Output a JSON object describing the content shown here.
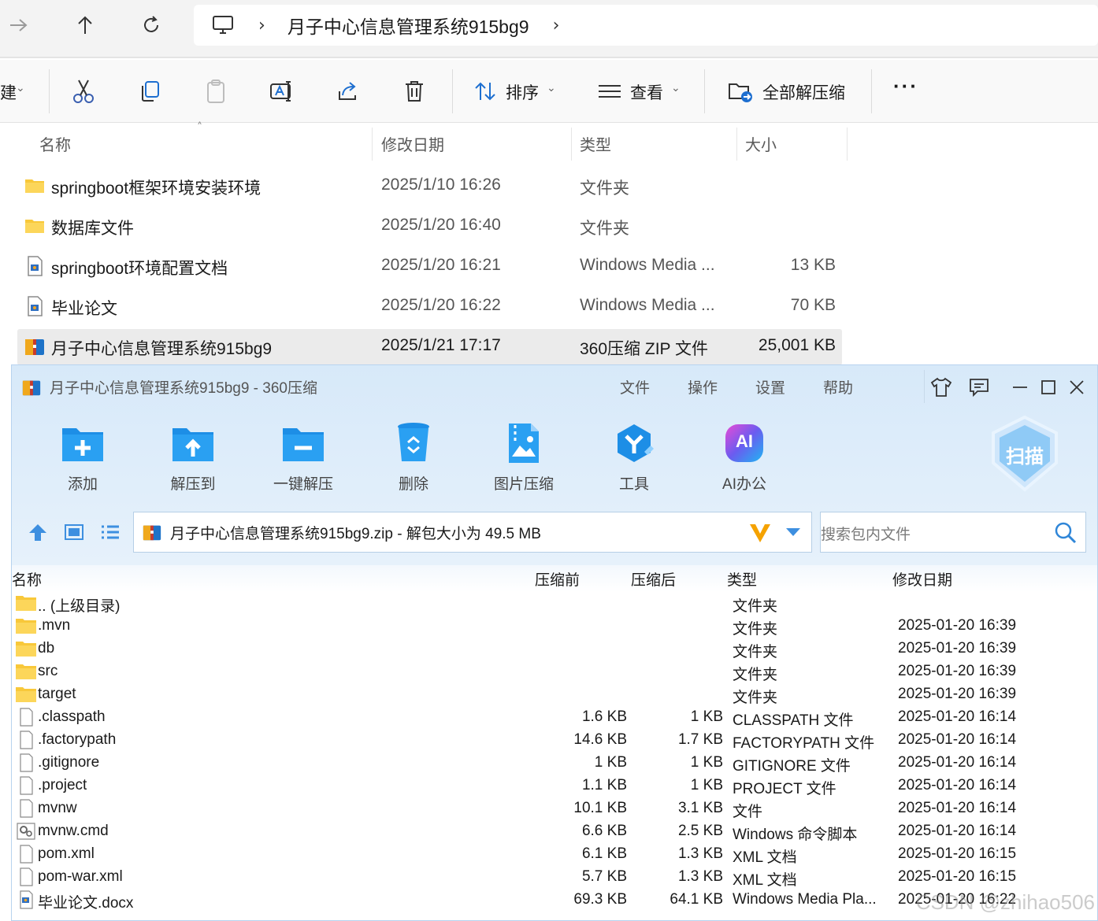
{
  "explorer": {
    "address_path": "月子中心信息管理系统915bg9",
    "toolbar": {
      "new_label_fragment": "建",
      "sort_label": "排序",
      "view_label": "查看",
      "extract_all_label": "全部解压缩"
    },
    "columns": {
      "name": "名称",
      "modified": "修改日期",
      "type": "类型",
      "size": "大小"
    },
    "files": [
      {
        "name": "springboot框架环境安装环境",
        "modified": "2025/1/10 16:26",
        "type": "文件夹",
        "size": "",
        "icon": "folder-icon"
      },
      {
        "name": "数据库文件",
        "modified": "2025/1/20 16:40",
        "type": "文件夹",
        "size": "",
        "icon": "folder-icon"
      },
      {
        "name": "springboot环境配置文档",
        "modified": "2025/1/20 16:21",
        "type": "Windows Media ...",
        "size": "13 KB",
        "icon": "document-icon"
      },
      {
        "name": "毕业论文",
        "modified": "2025/1/20 16:22",
        "type": "Windows Media ...",
        "size": "70 KB",
        "icon": "document-icon"
      },
      {
        "name": "月子中心信息管理系统915bg9",
        "modified": "2025/1/21 17:17",
        "type": "360压缩 ZIP 文件",
        "size": "25,001 KB",
        "icon": "zip-archive-icon"
      }
    ]
  },
  "zip_window": {
    "title": "月子中心信息管理系统915bg9 - 360压缩",
    "menu": [
      "文件",
      "操作",
      "设置",
      "帮助"
    ],
    "tools": [
      "添加",
      "解压到",
      "一键解压",
      "删除",
      "图片压缩",
      "工具",
      "AI办公"
    ],
    "scan_label": "扫描",
    "ai_badge": "AI",
    "path_text": "月子中心信息管理系统915bg9.zip - 解包大小为 49.5 MB",
    "search_placeholder": "搜索包内文件",
    "columns": {
      "name": "名称",
      "before": "压缩前",
      "after": "压缩后",
      "type": "类型",
      "modified": "修改日期"
    },
    "rows": [
      {
        "name": ".. (上级目录)",
        "before": "",
        "after": "",
        "type": "文件夹",
        "modified": "",
        "icon": "folder-icon"
      },
      {
        "name": ".mvn",
        "before": "",
        "after": "",
        "type": "文件夹",
        "modified": "2025-01-20 16:39",
        "icon": "folder-icon"
      },
      {
        "name": "db",
        "before": "",
        "after": "",
        "type": "文件夹",
        "modified": "2025-01-20 16:39",
        "icon": "folder-icon"
      },
      {
        "name": "src",
        "before": "",
        "after": "",
        "type": "文件夹",
        "modified": "2025-01-20 16:39",
        "icon": "folder-icon"
      },
      {
        "name": "target",
        "before": "",
        "after": "",
        "type": "文件夹",
        "modified": "2025-01-20 16:39",
        "icon": "folder-icon"
      },
      {
        "name": ".classpath",
        "before": "1.6 KB",
        "after": "1 KB",
        "type": "CLASSPATH 文件",
        "modified": "2025-01-20 16:14",
        "icon": "file-icon"
      },
      {
        "name": ".factorypath",
        "before": "14.6 KB",
        "after": "1.7 KB",
        "type": "FACTORYPATH 文件",
        "modified": "2025-01-20 16:14",
        "icon": "file-icon"
      },
      {
        "name": ".gitignore",
        "before": "1 KB",
        "after": "1 KB",
        "type": "GITIGNORE 文件",
        "modified": "2025-01-20 16:14",
        "icon": "file-icon"
      },
      {
        "name": ".project",
        "before": "1.1 KB",
        "after": "1 KB",
        "type": "PROJECT 文件",
        "modified": "2025-01-20 16:14",
        "icon": "file-icon"
      },
      {
        "name": "mvnw",
        "before": "10.1 KB",
        "after": "3.1 KB",
        "type": "文件",
        "modified": "2025-01-20 16:14",
        "icon": "file-icon"
      },
      {
        "name": "mvnw.cmd",
        "before": "6.6 KB",
        "after": "2.5 KB",
        "type": "Windows 命令脚本",
        "modified": "2025-01-20 16:14",
        "icon": "script-file-icon"
      },
      {
        "name": "pom.xml",
        "before": "6.1 KB",
        "after": "1.3 KB",
        "type": "XML 文档",
        "modified": "2025-01-20 16:15",
        "icon": "file-icon"
      },
      {
        "name": "pom-war.xml",
        "before": "5.7 KB",
        "after": "1.3 KB",
        "type": "XML 文档",
        "modified": "2025-01-20 16:15",
        "icon": "file-icon"
      },
      {
        "name": "毕业论文.docx",
        "before": "69.3 KB",
        "after": "64.1 KB",
        "type": "Windows Media Pla...",
        "modified": "2025-01-20 16:22",
        "icon": "document-icon"
      }
    ]
  },
  "watermark": "CSDN @zhihao506",
  "colors": {
    "zip_header_bg": "#d7e9f9",
    "folder_yellow": "#f8c83a",
    "tool_blue": "#1e8fe6",
    "selected_row": "#ebebeb"
  }
}
